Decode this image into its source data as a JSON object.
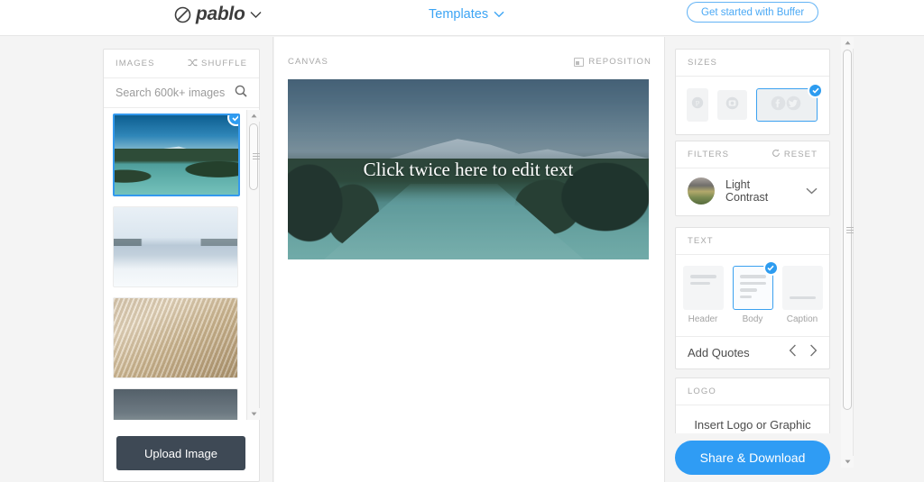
{
  "topbar": {
    "logo_text": "pablo",
    "logo_icon": "pablo-circle-slash-icon",
    "logo_caret_icon": "chevron-down-icon",
    "templates_label": "Templates",
    "templates_caret_icon": "chevron-down-icon",
    "buffer_button_label": "Get started with Buffer",
    "accent_blue": "#3ba4f4"
  },
  "images_panel": {
    "title": "IMAGES",
    "shuffle_label": "SHUFFLE",
    "shuffle_icon": "shuffle-icon",
    "search_placeholder": "Search 600k+ images",
    "search_value": "",
    "search_icon": "search-icon",
    "thumbnails": [
      {
        "name": "mountain-river-landscape",
        "selected": true,
        "check_icon": "check-icon"
      },
      {
        "name": "misty-lake",
        "selected": false,
        "check_icon": ""
      },
      {
        "name": "dried-grass-closeup",
        "selected": false,
        "check_icon": ""
      },
      {
        "name": "stormy-mountains",
        "selected": false,
        "check_icon": ""
      }
    ],
    "upload_button_label": "Upload Image",
    "upload_button_color": "#3e4955"
  },
  "canvas": {
    "title": "CANVAS",
    "reposition_label": "REPOSITION",
    "reposition_icon": "reposition-icon",
    "overlay_text": "Click twice here to edit text"
  },
  "right_panel": {
    "sizes": {
      "title": "SIZES",
      "options": [
        {
          "name": "pinterest-size",
          "icon": "pinterest-icon",
          "selected": false
        },
        {
          "name": "instagram-size",
          "icon": "instagram-icon",
          "selected": false
        },
        {
          "name": "facebook-twitter-size",
          "icon": "facebook-twitter-icon",
          "selected": true,
          "check_icon": "check-icon"
        }
      ]
    },
    "filters": {
      "title": "FILTERS",
      "reset_label": "RESET",
      "reset_icon": "reset-circle-icon",
      "selected_filter": "Light Contrast",
      "dropdown_icon": "chevron-down-icon"
    },
    "text": {
      "title": "TEXT",
      "options": [
        {
          "name": "text-header",
          "label": "Header",
          "selected": false
        },
        {
          "name": "text-body",
          "label": "Body",
          "selected": true,
          "check_icon": "check-icon"
        },
        {
          "name": "text-caption",
          "label": "Caption",
          "selected": false
        }
      ],
      "quotes_label": "Add Quotes",
      "prev_icon": "chevron-left-icon",
      "next_icon": "chevron-right-icon"
    },
    "logo": {
      "title": "LOGO",
      "insert_label": "Insert Logo or Graphic"
    },
    "share_button_label": "Share & Download",
    "share_button_color": "#2f9cf4"
  }
}
